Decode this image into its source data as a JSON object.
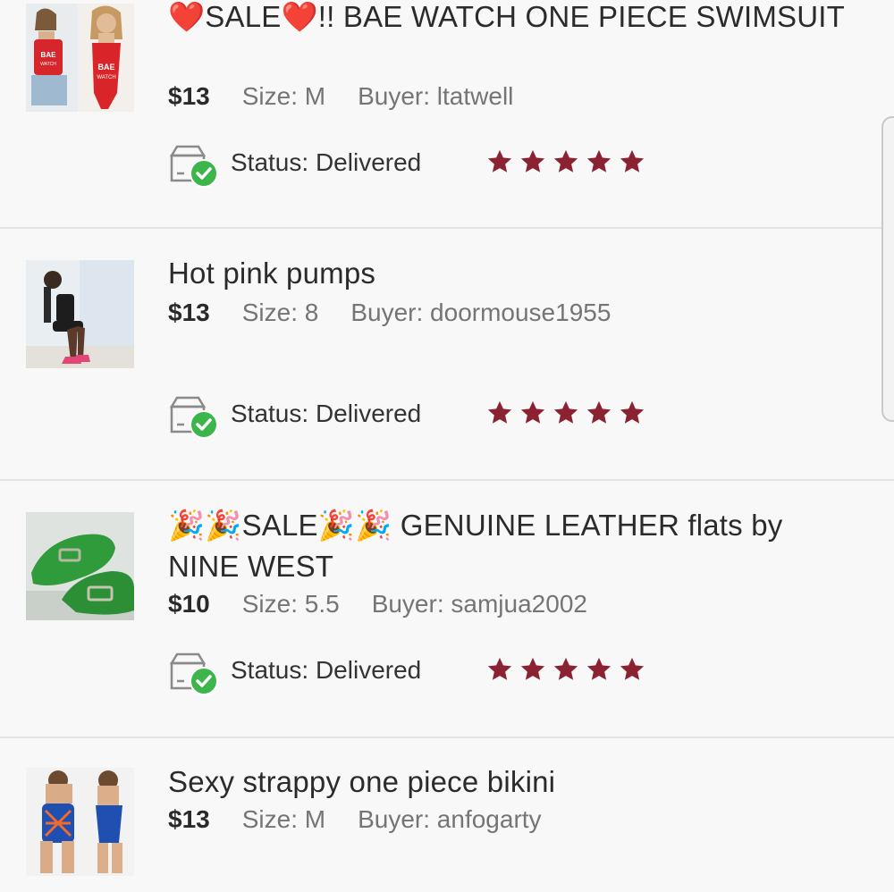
{
  "listings": [
    {
      "title": "❤️SALE❤️!! BAE WATCH ONE PIECE SWIMSUIT",
      "price": "$13",
      "size_label": "Size:",
      "size": "M",
      "buyer_label": "Buyer:",
      "buyer": "ltatwell",
      "status_label": "Status:",
      "status": "Delivered",
      "rating": 5,
      "thumb": "red-swimsuit-photo"
    },
    {
      "title": "Hot pink pumps",
      "price": "$13",
      "size_label": "Size:",
      "size": "8",
      "buyer_label": "Buyer:",
      "buyer": "doormouse1955",
      "status_label": "Status:",
      "status": "Delivered",
      "rating": 5,
      "thumb": "pink-pumps-photo"
    },
    {
      "title": "🎉🎉SALE🎉🎉 GENUINE LEATHER flats by NINE WEST",
      "price": "$10",
      "size_label": "Size:",
      "size": "5.5",
      "buyer_label": "Buyer:",
      "buyer": "samjua2002",
      "status_label": "Status:",
      "status": "Delivered",
      "rating": 5,
      "thumb": "green-flats-photo"
    },
    {
      "title": "Sexy strappy one piece bikini",
      "price": "$13",
      "size_label": "Size:",
      "size": "M",
      "buyer_label": "Buyer:",
      "buyer": "anfogarty",
      "thumb": "blue-bikini-photo"
    }
  ],
  "colors": {
    "star": "#8b2232",
    "check": "#3cb54a",
    "divider": "#e3e3e3"
  },
  "icons": {
    "status": "delivered-box-icon",
    "rating": "star-icon"
  }
}
